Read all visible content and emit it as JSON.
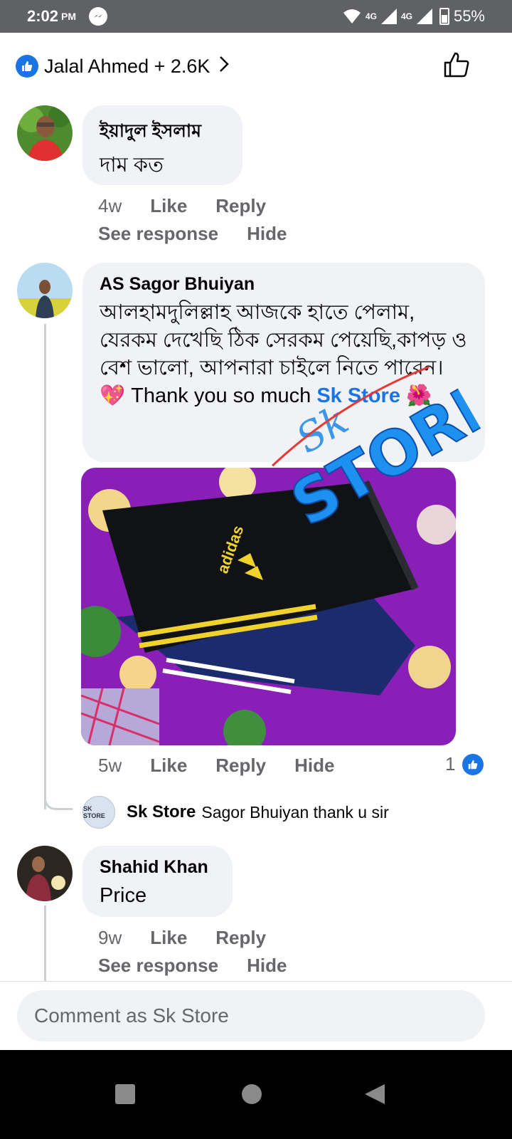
{
  "status": {
    "time": "2:02",
    "ampm": "PM",
    "net1": "4G",
    "net2": "4G",
    "battery": "55%"
  },
  "header": {
    "reactors": "Jalal Ahmed + 2.6K"
  },
  "comments": [
    {
      "author": "ইয়াদুল ইসলাম",
      "text": "দাম কত",
      "time": "4w",
      "like": "Like",
      "reply": "Reply",
      "see_response": "See response",
      "hide": "Hide"
    },
    {
      "author": "AS Sagor Bhuiyan",
      "text": "আলহামদুলিল্লাহ আজকে হাতে পেলাম, যেরকম দেখেছি ঠিক সেরকম পেয়েছি,কাপড় ও বেশ ভালো, আপনারা চাইলে নিতে পারেন। 💖 Thank you so much",
      "mention": "Sk Store",
      "emoji": "🌺",
      "time": "5w",
      "like": "Like",
      "reply": "Reply",
      "hide": "Hide",
      "reaction_count": "1",
      "photo_logo": "adidas",
      "reply_item": {
        "author": "Sk Store",
        "text": "Sagor Bhuiyan  thank u sir",
        "avatar_text": "SK STORE"
      }
    },
    {
      "author": "Shahid Khan",
      "text": "Price",
      "time": "9w",
      "like": "Like",
      "reply": "Reply",
      "see_response": "See response",
      "hide": "Hide"
    }
  ],
  "watermark": {
    "line1": "Sk",
    "line2": "STORE"
  },
  "composer": {
    "placeholder": "Comment as Sk Store"
  },
  "colors": {
    "accent": "#1b74e4",
    "bubble": "#f0f2f5",
    "meta": "#65676b"
  }
}
